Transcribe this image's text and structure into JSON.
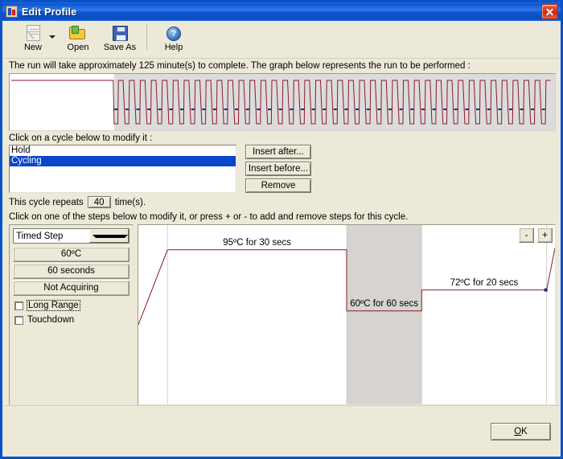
{
  "window": {
    "title": "Edit Profile",
    "icon": "profile-window-icon",
    "close_label": "x",
    "accent": "#0a51c8",
    "face": "#ece9d8"
  },
  "toolbar": {
    "items": [
      {
        "label": "New",
        "icon": "new-document-icon",
        "disabled": true
      },
      {
        "label": "Open",
        "icon": "open-folder-icon",
        "disabled": false
      },
      {
        "label": "Save As",
        "icon": "save-diskette-icon",
        "disabled": false
      },
      {
        "label": "Help",
        "icon": "help-question-icon",
        "disabled": false
      }
    ],
    "dropdown_arrow": "new-dropdown-arrow-icon"
  },
  "run_summary": "The run will take approximately 125 minute(s) to complete. The graph below represents the run to be performed :",
  "profile_graph": {
    "hold_fraction": 0.19,
    "cycle_count": 40,
    "line_color": "#8b1a29",
    "acquire_color": "#282874",
    "cycle_bg": "#dcdcdc",
    "hold_bg": "#ffffff"
  },
  "cycles": {
    "prompt": "Click on a cycle below to modify it :",
    "items": [
      {
        "label": "Hold",
        "selected": false
      },
      {
        "label": "Cycling",
        "selected": true
      }
    ],
    "buttons": [
      {
        "label": "Insert after..."
      },
      {
        "label": "Insert before..."
      },
      {
        "label": "Remove"
      }
    ],
    "repeat_prefix": "This cycle repeats",
    "repeat_value": "40",
    "repeat_suffix": "time(s)."
  },
  "steps": {
    "prompt": "Click on one of the steps below to modify it, or press + or - to add and remove steps for this cycle.",
    "step_type": "Timed Step",
    "temperature": "60º C",
    "temperature_display": "60ºC",
    "duration": "60 seconds",
    "acquisition": "Not Acquiring",
    "checkboxes": [
      {
        "label": "Long Range",
        "checked": false,
        "focused": true
      },
      {
        "label": "Touchdown",
        "checked": false,
        "focused": false
      }
    ],
    "add_button": "+",
    "remove_button": "-",
    "chart": {
      "selected_index": 1,
      "segments": [
        {
          "label": "95ºC for 30 secs",
          "temp_c": 95,
          "secs": 30,
          "selected": false
        },
        {
          "label": "60ºC for 60 secs",
          "temp_c": 60,
          "secs": 60,
          "selected": true
        },
        {
          "label": "72ºC for 20 secs",
          "temp_c": 72,
          "secs": 20,
          "selected": false
        }
      ],
      "line_color": "#8b1a29",
      "selected_bg": "#d6d3d0"
    }
  },
  "footer": {
    "ok_label": "OK",
    "ok_mnemonic": "O"
  }
}
